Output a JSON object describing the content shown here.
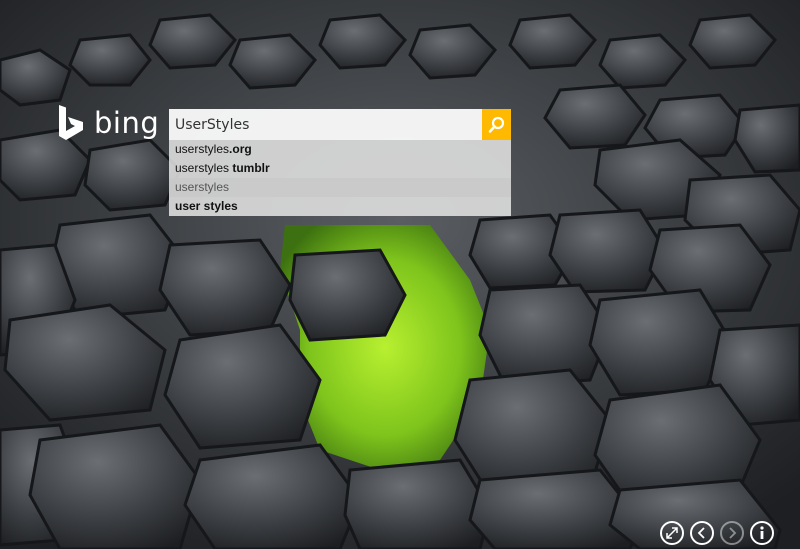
{
  "logo": {
    "text": "bing",
    "color": "#ffffff"
  },
  "search": {
    "value": "UserStyles",
    "button_color": "#ffb900",
    "suggestions": [
      {
        "prefix": "userstyles",
        "bold": ".org"
      },
      {
        "prefix": "userstyles ",
        "bold": "tumblr"
      },
      {
        "prefix": "userstyles",
        "bold": ""
      },
      {
        "prefix": "",
        "bold": "user styles"
      }
    ]
  },
  "controls": [
    {
      "icon": "expand-icon"
    },
    {
      "icon": "previous-icon"
    },
    {
      "icon": "next-icon"
    },
    {
      "icon": "info-icon"
    }
  ],
  "background": {
    "subject": "hexagonal basalt columns with green algae"
  }
}
